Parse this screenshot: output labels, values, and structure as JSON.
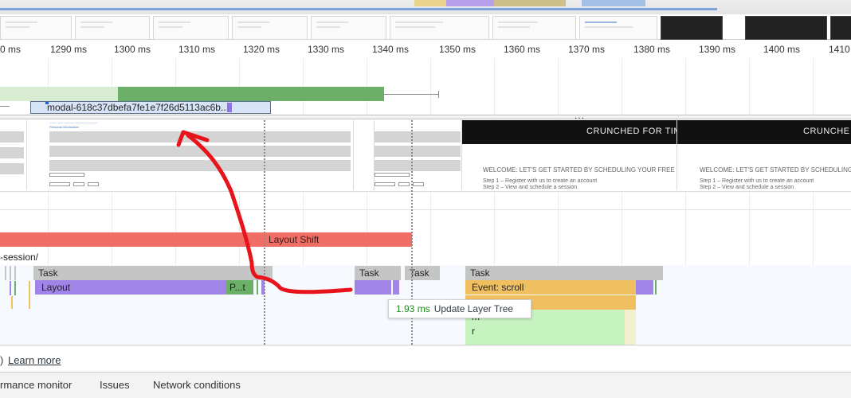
{
  "ruler": {
    "ticks": [
      "0 ms",
      "1290 ms",
      "1300 ms",
      "1310 ms",
      "1320 ms",
      "1330 ms",
      "1340 ms",
      "1350 ms",
      "1360 ms",
      "1370 ms",
      "1380 ms",
      "1390 ms",
      "1400 ms",
      "1410"
    ]
  },
  "network": {
    "request_label": "modal-618c37dbefa7fe1e7f26d5113ac6b..."
  },
  "splitter": {
    "dots": "..."
  },
  "frames": {
    "header_text_1": "CRUNCHED FOR TIM",
    "header_text_2": "CRUNCHE",
    "welcome_1": "WELCOME: LET'S GET STARTED BY SCHEDULING YOUR FREE INTR",
    "welcome_2": "WELCOME: LET'S GET STARTED BY SCHEDULING YOUR",
    "step1": "Step 1 – Register with us to create an account",
    "step2": "Step 2 – View and schedule a session",
    "personal_info": "Personal Information"
  },
  "layout_shift": {
    "label": "Layout Shift"
  },
  "url_fragment": "-session/",
  "main_thread": {
    "task_label": "Task",
    "layout_label": "Layout",
    "paint_label": "P...t",
    "event_scroll_label": "Event: scroll",
    "event_sub_1": "m",
    "event_sub_2": "r"
  },
  "tooltip": {
    "duration": "1.93 ms",
    "label": "Update Layer Tree"
  },
  "learn_more": {
    "prefix": ")",
    "link": "Learn more"
  },
  "drawer_tabs": [
    "rmance monitor",
    "Issues",
    "Network conditions"
  ],
  "colors": {
    "network_bar": "#6cb068",
    "layout_shift": "#f06e66",
    "task": "#c5c5c5",
    "layout": "#a084e8",
    "scripting": "#f0c060",
    "annotation": "#e8141c"
  }
}
